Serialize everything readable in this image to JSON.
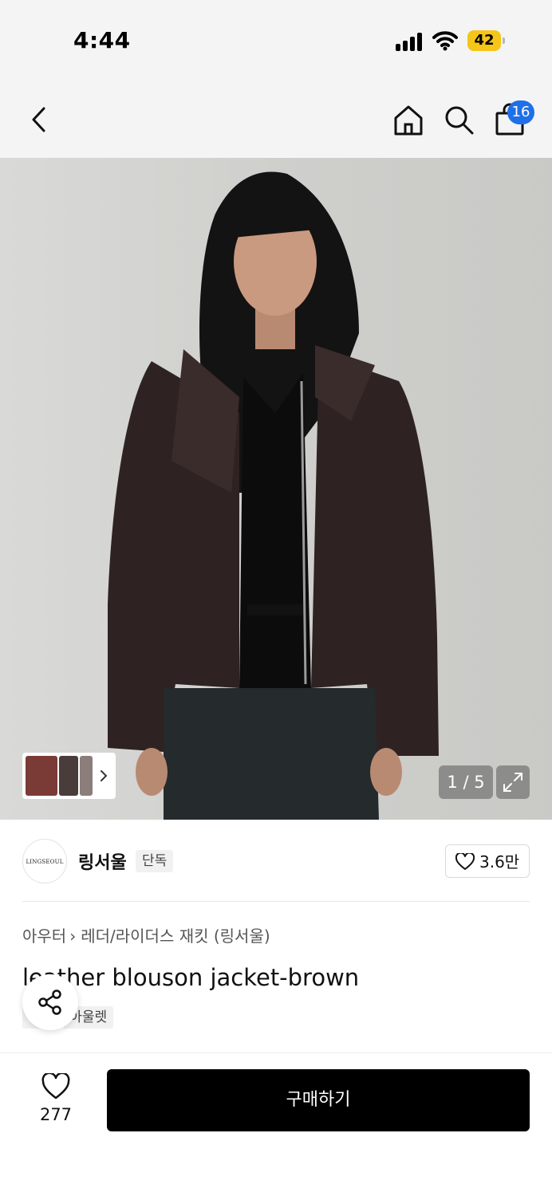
{
  "status_bar": {
    "time": "4:44",
    "battery": "42"
  },
  "header": {
    "cart_count": "16"
  },
  "gallery": {
    "counter": "1 / 5"
  },
  "brand": {
    "logo_text": "LINGSEOUL",
    "name": "링서울",
    "tag": "단독",
    "like_count": "3.6만"
  },
  "product": {
    "breadcrumbs": [
      "아우터",
      "레더/라이더스 재킷 (링서울)"
    ],
    "title": "leather blouson jacket-brown",
    "tags": [
      "단독",
      "아울렛"
    ]
  },
  "bottom_bar": {
    "wish_count": "277",
    "buy_label": "구매하기"
  },
  "colors": {
    "accent_blue": "#1f6fe8",
    "battery_yellow": "#f5c518",
    "buy_button": "#000000"
  }
}
